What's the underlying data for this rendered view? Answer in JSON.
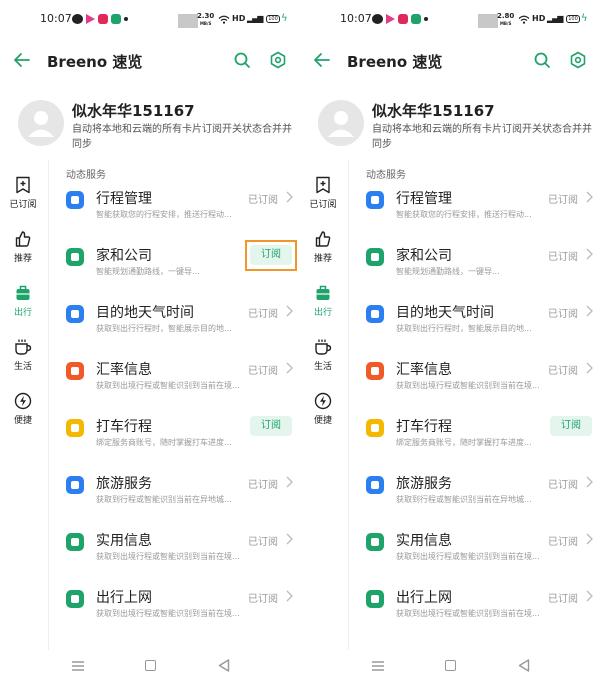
{
  "colors": {
    "accent": "#1ea36b",
    "highlight_box": "#f0962a",
    "subscribe_bg": "#e3f5ec",
    "muted_text": "#999999"
  },
  "screens": [
    {
      "status_bar": {
        "time": "10:07",
        "net_speed": "2.30",
        "net_unit": "MB/S",
        "hd": "HD",
        "signal": "⁴ᴳ",
        "battery": "100",
        "notif_icons": [
          "wechat-icon",
          "video-play-icon",
          "video-icon",
          "game-icon"
        ]
      },
      "app_bar": {
        "title": "Breeno 速览",
        "icons": [
          "back-arrow-icon",
          "search-icon",
          "settings-icon"
        ]
      },
      "profile": {
        "name": "似水年华151167",
        "description": "自动将本地和云端的所有卡片订阅开关状态合并并同步"
      },
      "sidebar": [
        {
          "label": "已订阅",
          "icon": "add-bookmark-icon",
          "active": false
        },
        {
          "label": "推荐",
          "icon": "thumbs-up-icon",
          "active": false
        },
        {
          "label": "出行",
          "icon": "suitcase-icon",
          "active": true
        },
        {
          "label": "生活",
          "icon": "coffee-icon",
          "active": false
        },
        {
          "label": "便捷",
          "icon": "lightning-icon",
          "active": false
        }
      ],
      "section_title": "动态服务",
      "services": [
        {
          "title": "行程管理",
          "desc": "智能获取您的行程安排，推送行程动...",
          "status": "已订阅",
          "subscribed": true,
          "color": "#2b7ff0",
          "highlight": false
        },
        {
          "title": "家和公司",
          "desc": "智能规划通勤路线，一键导...",
          "status": "订阅",
          "subscribed": false,
          "color": "#1ea36b",
          "highlight": true
        },
        {
          "title": "目的地天气时间",
          "desc": "获取到出行行程时，智能展示目的地...",
          "status": "已订阅",
          "subscribed": true,
          "color": "#2b7ff0",
          "highlight": false
        },
        {
          "title": "汇率信息",
          "desc": "获取到出境行程或智能识别到当前在境...",
          "status": "已订阅",
          "subscribed": true,
          "color": "#f05a28",
          "highlight": false
        },
        {
          "title": "打车行程",
          "desc": "绑定服务商账号，随时掌握打车进度...",
          "status": "订阅",
          "subscribed": false,
          "color": "#f5b800",
          "highlight": false
        },
        {
          "title": "旅游服务",
          "desc": "获取到行程或智能识别当前在异地城...",
          "status": "已订阅",
          "subscribed": true,
          "color": "#2b7ff0",
          "highlight": false
        },
        {
          "title": "实用信息",
          "desc": "获取到出境行程或智能识别到当前在境...",
          "status": "已订阅",
          "subscribed": true,
          "color": "#1ea36b",
          "highlight": false
        },
        {
          "title": "出行上网",
          "desc": "获取到出境行程或智能识别到当前在境...",
          "status": "已订阅",
          "subscribed": true,
          "color": "#1ea36b",
          "highlight": false
        }
      ]
    },
    {
      "status_bar": {
        "time": "10:07",
        "net_speed": "2.80",
        "net_unit": "MB/S",
        "hd": "HD",
        "signal": "⁴ᴳ",
        "battery": "100",
        "notif_icons": [
          "wechat-icon",
          "video-play-icon",
          "video-icon",
          "game-icon"
        ]
      },
      "app_bar": {
        "title": "Breeno 速览",
        "icons": [
          "back-arrow-icon",
          "search-icon",
          "settings-icon"
        ]
      },
      "profile": {
        "name": "似水年华151167",
        "description": "自动将本地和云端的所有卡片订阅开关状态合并并同步"
      },
      "sidebar": [
        {
          "label": "已订阅",
          "icon": "add-bookmark-icon",
          "active": false
        },
        {
          "label": "推荐",
          "icon": "thumbs-up-icon",
          "active": false
        },
        {
          "label": "出行",
          "icon": "suitcase-icon",
          "active": true
        },
        {
          "label": "生活",
          "icon": "coffee-icon",
          "active": false
        },
        {
          "label": "便捷",
          "icon": "lightning-icon",
          "active": false
        }
      ],
      "section_title": "动态服务",
      "services": [
        {
          "title": "行程管理",
          "desc": "智能获取您的行程安排，推送行程动...",
          "status": "已订阅",
          "subscribed": true,
          "color": "#2b7ff0",
          "highlight": false
        },
        {
          "title": "家和公司",
          "desc": "智能规划通勤路线，一键导...",
          "status": "已订阅",
          "subscribed": true,
          "color": "#1ea36b",
          "highlight": false
        },
        {
          "title": "目的地天气时间",
          "desc": "获取到出行行程时，智能展示目的地...",
          "status": "已订阅",
          "subscribed": true,
          "color": "#2b7ff0",
          "highlight": false
        },
        {
          "title": "汇率信息",
          "desc": "获取到出境行程或智能识别到当前在境...",
          "status": "已订阅",
          "subscribed": true,
          "color": "#f05a28",
          "highlight": false
        },
        {
          "title": "打车行程",
          "desc": "绑定服务商账号，随时掌握打车进度...",
          "status": "订阅",
          "subscribed": false,
          "color": "#f5b800",
          "highlight": false
        },
        {
          "title": "旅游服务",
          "desc": "获取到行程或智能识别当前在异地城...",
          "status": "已订阅",
          "subscribed": true,
          "color": "#2b7ff0",
          "highlight": false
        },
        {
          "title": "实用信息",
          "desc": "获取到出境行程或智能识别到当前在境...",
          "status": "已订阅",
          "subscribed": true,
          "color": "#1ea36b",
          "highlight": false
        },
        {
          "title": "出行上网",
          "desc": "获取到出境行程或智能识别到当前在境...",
          "status": "已订阅",
          "subscribed": true,
          "color": "#1ea36b",
          "highlight": false
        }
      ]
    }
  ]
}
